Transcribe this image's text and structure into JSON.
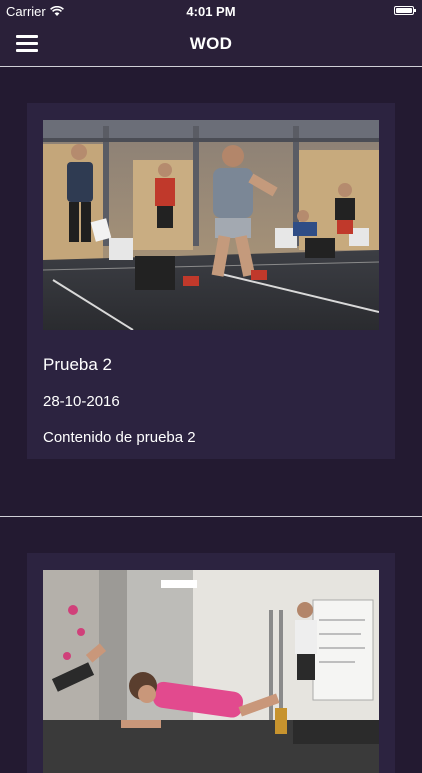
{
  "status_bar": {
    "carrier": "Carrier",
    "time": "4:01 PM"
  },
  "nav": {
    "title": "WOD",
    "menu_icon": "hamburger-menu-icon"
  },
  "posts": [
    {
      "title": "Prueba 2",
      "date": "28-10-2016",
      "content": "Contenido de prueba 2"
    },
    {
      "title": "",
      "date": "",
      "content": ""
    }
  ],
  "colors": {
    "background": "#231a31",
    "card": "#2c2340",
    "bar": "#2a2039",
    "separator": "#cfcfd6",
    "text": "#ffffff"
  }
}
